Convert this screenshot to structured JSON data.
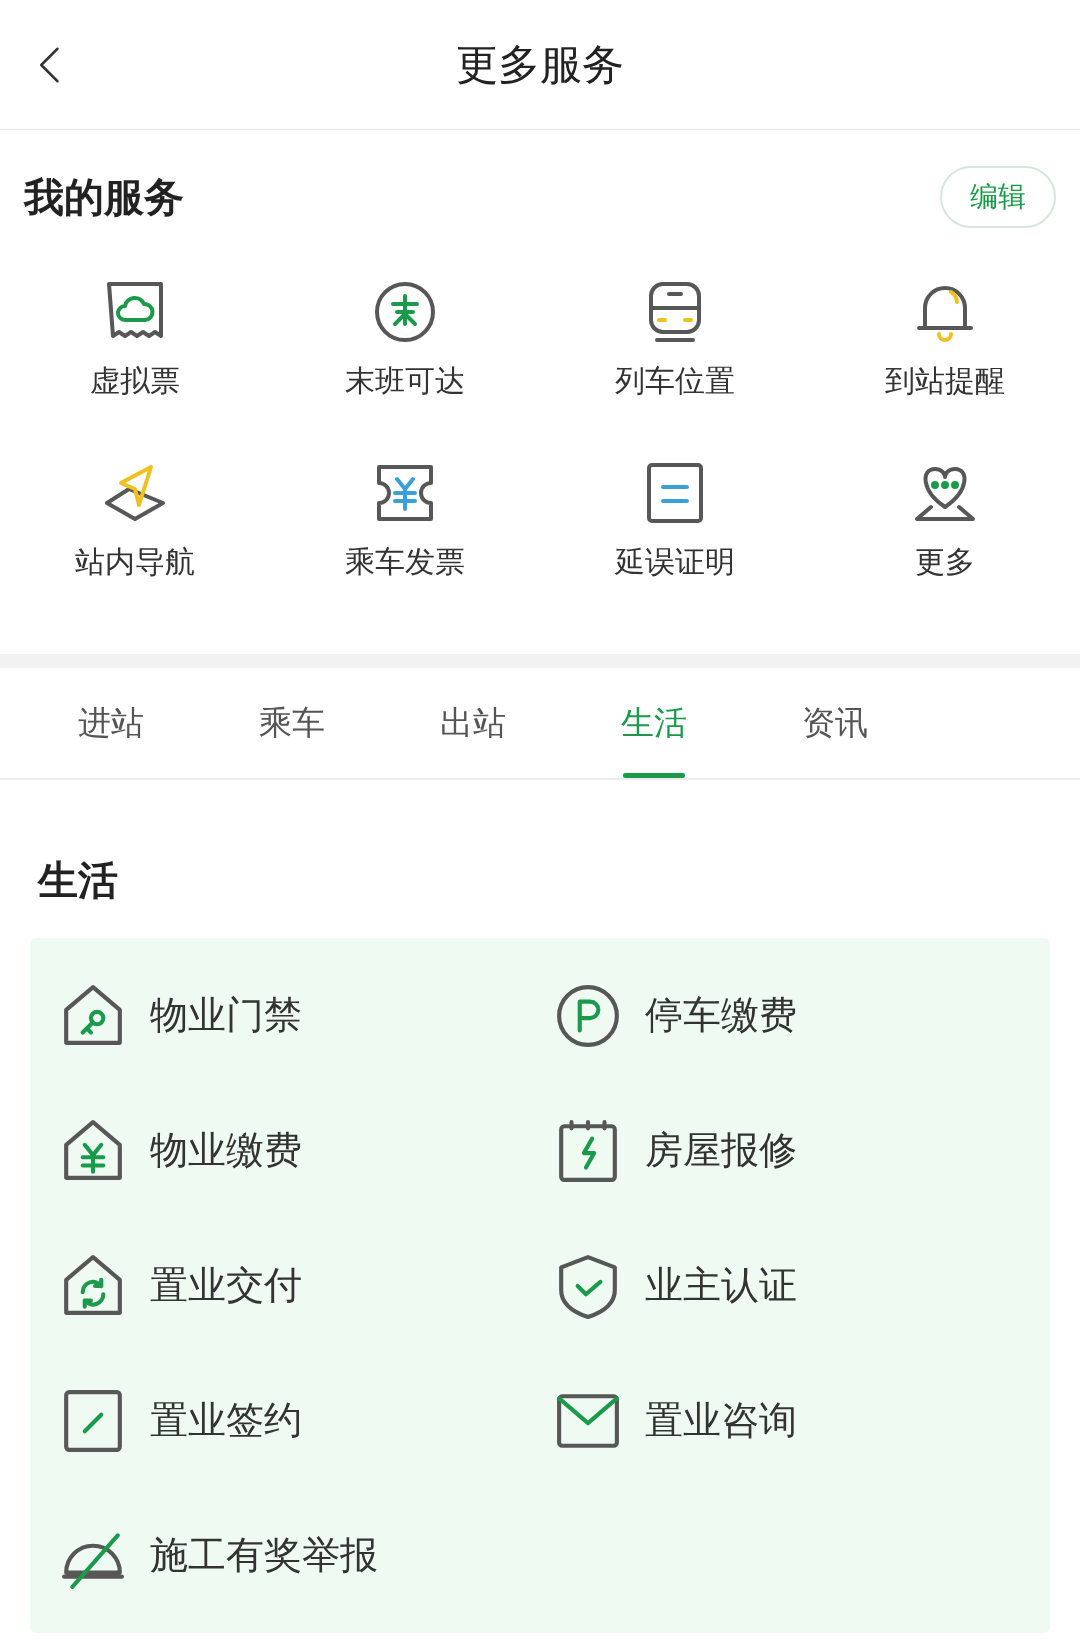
{
  "header": {
    "title": "更多服务"
  },
  "my_services": {
    "title": "我的服务",
    "edit_button": "编辑",
    "items": [
      {
        "label": "虚拟票"
      },
      {
        "label": "末班可达"
      },
      {
        "label": "列车位置"
      },
      {
        "label": "到站提醒"
      },
      {
        "label": "站内导航"
      },
      {
        "label": "乘车发票"
      },
      {
        "label": "延误证明"
      },
      {
        "label": "更多"
      }
    ]
  },
  "tabs": [
    {
      "label": "进站",
      "selected": false
    },
    {
      "label": "乘车",
      "selected": false
    },
    {
      "label": "出站",
      "selected": false
    },
    {
      "label": "生活",
      "selected": true
    },
    {
      "label": "资讯",
      "selected": false
    }
  ],
  "section": {
    "title": "生活",
    "items": [
      {
        "label": "物业门禁"
      },
      {
        "label": "停车缴费"
      },
      {
        "label": "物业缴费"
      },
      {
        "label": "房屋报修"
      },
      {
        "label": "置业交付"
      },
      {
        "label": "业主认证"
      },
      {
        "label": "置业签约"
      },
      {
        "label": "置业咨询"
      },
      {
        "label": "施工有奖举报"
      }
    ]
  }
}
